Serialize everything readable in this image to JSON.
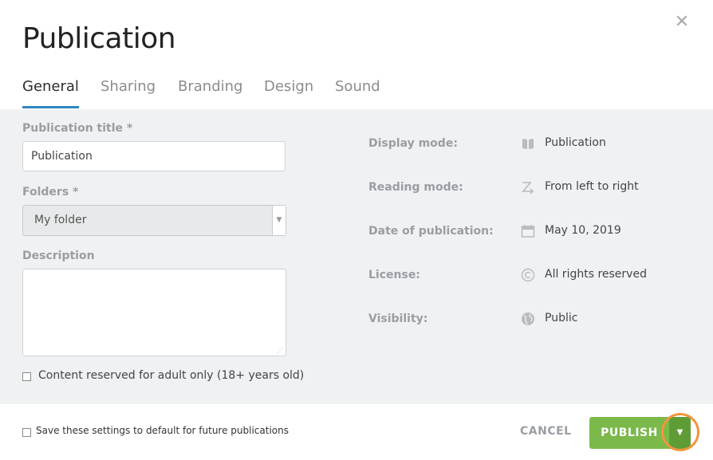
{
  "dialog": {
    "title": "Publication"
  },
  "tabs": [
    {
      "label": "General",
      "active": true
    },
    {
      "label": "Sharing",
      "active": false
    },
    {
      "label": "Branding",
      "active": false
    },
    {
      "label": "Design",
      "active": false
    },
    {
      "label": "Sound",
      "active": false
    }
  ],
  "form": {
    "title_label": "Publication title *",
    "title_value": "Publication",
    "folders_label": "Folders *",
    "folders_value": "My folder",
    "description_label": "Description",
    "description_value": "",
    "adult_label": "Content reserved for adult only (18+ years old)"
  },
  "details": [
    {
      "label": "Display mode:",
      "icon": "book-icon",
      "value": "Publication"
    },
    {
      "label": "Reading mode:",
      "icon": "left-to-right-icon",
      "value": "From left to right"
    },
    {
      "label": "Date of publication:",
      "icon": "calendar-icon",
      "value": "May 10, 2019"
    },
    {
      "label": "License:",
      "icon": "copyright-icon",
      "value": "All rights reserved"
    },
    {
      "label": "Visibility:",
      "icon": "globe-icon",
      "value": "Public"
    }
  ],
  "footer": {
    "save_default_label": "Save these settings to default for future publications",
    "cancel_label": "CANCEL",
    "publish_label": "PUBLISH"
  },
  "colors": {
    "accent_tab": "#2f87c2",
    "publish": "#7bb94b",
    "publish_dropdown": "#5f9c36",
    "highlight": "#f0963c",
    "panel_bg": "#eff1f3"
  }
}
